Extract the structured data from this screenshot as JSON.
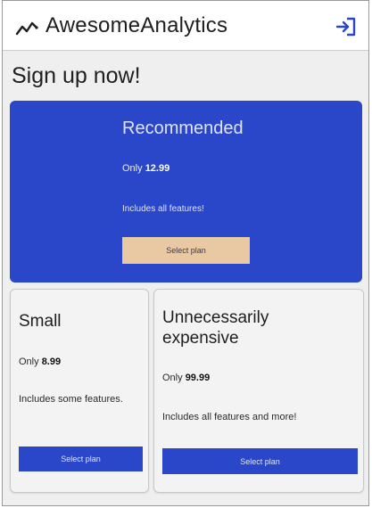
{
  "header": {
    "app_title": "AwesomeAnalytics",
    "logo_icon": "trend-line-icon",
    "login_icon": "login-arrow-icon",
    "accent_color": "#2a47c9"
  },
  "main": {
    "heading": "Sign up now!",
    "plans": [
      {
        "name": "Recommended",
        "price_prefix": "Only",
        "price": "12.99",
        "description": "Includes all features!",
        "button_label": "Select plan",
        "highlighted": true,
        "card_color": "#2a47c9",
        "button_color": "#e9c9a4"
      },
      {
        "name": "Small",
        "price_prefix": "Only",
        "price": "8.99",
        "description": "Includes some features.",
        "button_label": "Select plan",
        "button_color": "#2a47c9"
      },
      {
        "name": "Unnecessarily expensive",
        "price_prefix": "Only",
        "price": "99.99",
        "description": "Includes all features and more!",
        "button_label": "Select plan",
        "button_color": "#2a47c9"
      }
    ]
  }
}
